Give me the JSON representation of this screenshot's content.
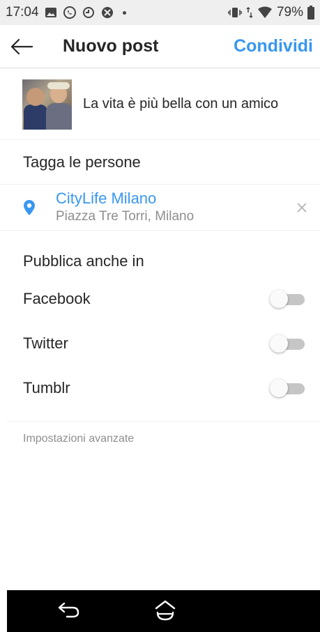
{
  "status_bar": {
    "time": "17:04",
    "battery": "79%",
    "icons": [
      "gallery-icon",
      "whatsapp-icon",
      "sync-icon",
      "app-icon",
      "vibrate-icon",
      "data-arrows-icon",
      "wifi-icon",
      "battery-icon"
    ]
  },
  "header": {
    "title": "Nuovo post",
    "share_label": "Condividi"
  },
  "post": {
    "caption": "La vita è più bella con un amico"
  },
  "tag_people": {
    "label": "Tagga le persone"
  },
  "location": {
    "name": "CityLife Milano",
    "address": "Piazza Tre Torri, Milano"
  },
  "publish_also": {
    "heading": "Pubblica anche in",
    "items": [
      {
        "label": "Facebook",
        "enabled": false
      },
      {
        "label": "Twitter",
        "enabled": false
      },
      {
        "label": "Tumblr",
        "enabled": false
      }
    ]
  },
  "advanced": {
    "label": "Impostazioni avanzate"
  },
  "colors": {
    "accent": "#3897f0",
    "text": "#262626",
    "secondary_text": "#8e8e8e",
    "toggle_off_track": "#c6c6c6"
  }
}
